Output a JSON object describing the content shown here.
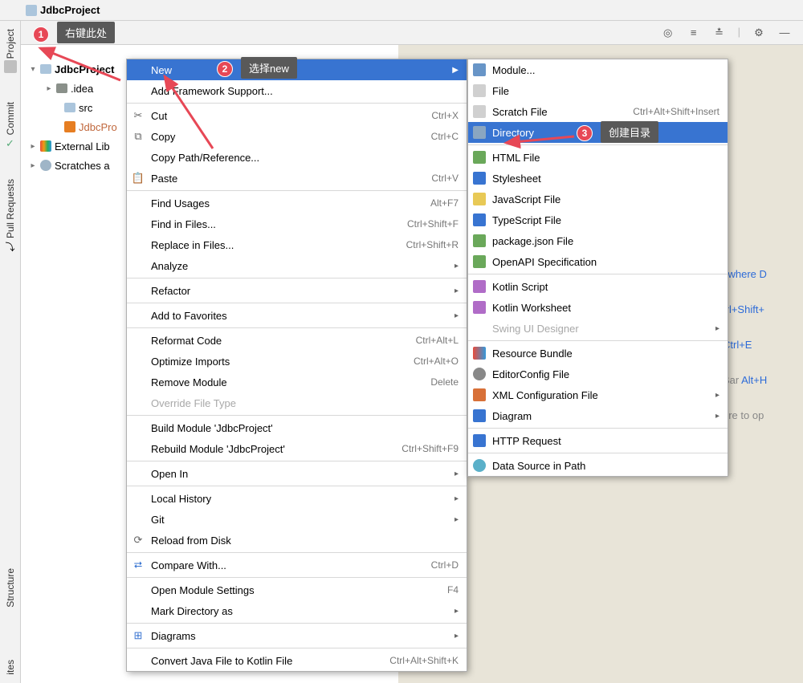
{
  "breadcrumb": {
    "title": "JdbcProject"
  },
  "project_tool": {
    "label": "Project"
  },
  "side": {
    "project": "Project",
    "commit": "Commit",
    "pull": "Pull Requests",
    "structure": "Structure"
  },
  "tree": {
    "root": "JdbcProject",
    "idea": ".idea",
    "src": "src",
    "iml": "JdbcPro",
    "extlib": "External Lib",
    "scratch": "Scratches a"
  },
  "ctx1": {
    "new": "New",
    "add_framework": "Add Framework Support...",
    "cut": "Cut",
    "cut_sc": "Ctrl+X",
    "copy": "Copy",
    "copy_sc": "Ctrl+C",
    "copy_path": "Copy Path/Reference...",
    "paste": "Paste",
    "paste_sc": "Ctrl+V",
    "find_usages": "Find Usages",
    "find_usages_sc": "Alt+F7",
    "find_in_files": "Find in Files...",
    "fif_sc": "Ctrl+Shift+F",
    "replace_in_files": "Replace in Files...",
    "rif_sc": "Ctrl+Shift+R",
    "analyze": "Analyze",
    "refactor": "Refactor",
    "add_fav": "Add to Favorites",
    "reformat": "Reformat Code",
    "reformat_sc": "Ctrl+Alt+L",
    "optimize": "Optimize Imports",
    "optimize_sc": "Ctrl+Alt+O",
    "remove_module": "Remove Module",
    "remove_sc": "Delete",
    "override_ft": "Override File Type",
    "build": "Build Module 'JdbcProject'",
    "rebuild": "Rebuild Module 'JdbcProject'",
    "rebuild_sc": "Ctrl+Shift+F9",
    "open_in": "Open In",
    "local_history": "Local History",
    "git": "Git",
    "reload": "Reload from Disk",
    "compare": "Compare With...",
    "compare_sc": "Ctrl+D",
    "open_module": "Open Module Settings",
    "open_module_sc": "F4",
    "mark_dir": "Mark Directory as",
    "diagrams": "Diagrams",
    "convert_kotlin": "Convert Java File to Kotlin File",
    "convert_sc": "Ctrl+Alt+Shift+K"
  },
  "ctx2": {
    "module": "Module...",
    "file": "File",
    "scratch": "Scratch File",
    "scratch_sc": "Ctrl+Alt+Shift+Insert",
    "directory": "Directory",
    "html": "HTML File",
    "stylesheet": "Stylesheet",
    "js": "JavaScript File",
    "ts": "TypeScript File",
    "pkg_json": "package.json File",
    "openapi": "OpenAPI Specification",
    "kotlin_script": "Kotlin Script",
    "kotlin_ws": "Kotlin Worksheet",
    "swing": "Swing UI Designer",
    "resource_bundle": "Resource Bundle",
    "editor_config": "EditorConfig File",
    "xml": "XML Configuration File",
    "diagram": "Diagram",
    "http": "HTTP Request",
    "datasource": "Data Source in Path"
  },
  "callouts": {
    "c1": "右键此处",
    "c2": "选择new",
    "c3": "创建目录"
  },
  "bg": {
    "everywhere": "ywhere D",
    "ctrlshift": "trl+Shift+",
    "ctrle": "Ctrl+E",
    "bar": "Bar Alt+H",
    "ere": "ere to op"
  }
}
